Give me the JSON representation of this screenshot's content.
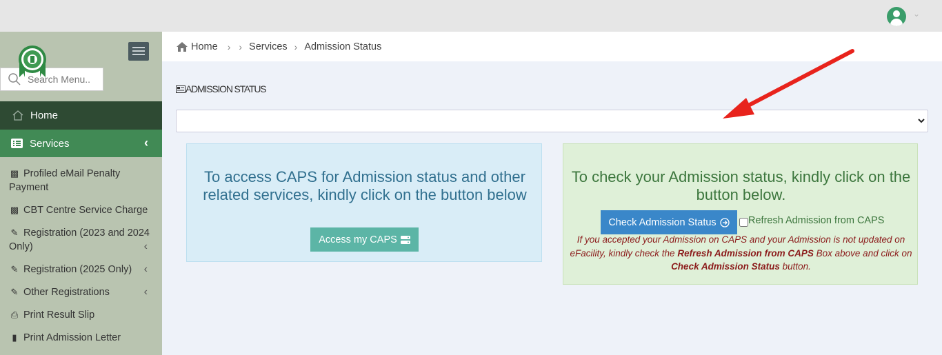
{
  "colors": {
    "sidebar_bg": "#b9c4b0",
    "home_active": "#2e4a33",
    "services_active": "#418a55",
    "info_panel": "#d9edf7",
    "success_panel": "#dff0d8",
    "caps_button": "#5cb5a6",
    "check_button": "#3a87c9",
    "annotation_arrow": "#e8231c"
  },
  "header": {
    "avatar_icon": "user-avatar-icon",
    "dropdown_icon": "chevron-down-icon"
  },
  "sidebar": {
    "search_placeholder": "Search Menu..",
    "home_label": "Home",
    "services_label": "Services",
    "items": [
      {
        "label": "Profiled eMail Penalty Payment",
        "icon": "money-icon"
      },
      {
        "label": "CBT Centre Service Charge",
        "icon": "money-icon"
      },
      {
        "label": "Registration (2023 and 2024 Only)",
        "icon": "edit-icon"
      },
      {
        "label": "Registration (2025 Only)",
        "icon": "edit-icon"
      },
      {
        "label": "Other Registrations",
        "icon": "edit-icon"
      },
      {
        "label": "Print Result Slip",
        "icon": "print-icon"
      },
      {
        "label": "Print Admission Letter",
        "icon": "document-icon"
      }
    ]
  },
  "breadcrumb": {
    "home": "Home",
    "services": "Services",
    "current": "Admission Status"
  },
  "main": {
    "title": "ADMISSION STATUS",
    "select_value": "",
    "caps_panel": {
      "message": "To access CAPS for Admission status and other related services, kindly click on the button below",
      "button": "Access my CAPS"
    },
    "status_panel": {
      "message": "To check your Admission status, kindly click on the button below.",
      "button": "Check Admission Status",
      "checkbox_label": "Refresh Admission from CAPS",
      "checkbox_checked": false,
      "note_1": "If you accepted your Admission on CAPS and your Admission is not updated on eFacility, kindly check the",
      "note_bold_1": "Refresh Admission from CAPS",
      "note_2": "Box above and click on",
      "note_bold_2": "Check Admission Status",
      "note_3": "button."
    }
  }
}
